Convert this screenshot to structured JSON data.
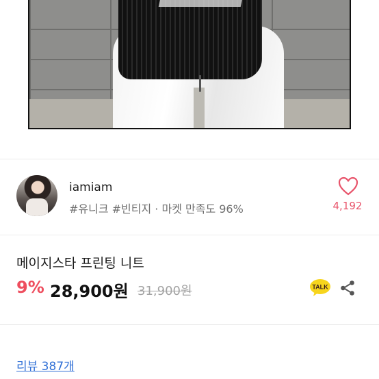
{
  "product_image": {
    "alt": ""
  },
  "seller": {
    "name": "iamiam",
    "tags": "#유니크 #빈티지 · 마켓 만족도 96%",
    "likes": "4,192"
  },
  "product": {
    "title": "메이지스타 프린팅 니트",
    "discount": "9%",
    "price": "28,900원",
    "original_price": "31,900원"
  },
  "actions": {
    "chat_badge": "TALK"
  },
  "reviews": {
    "label": "리뷰 387개"
  },
  "colors": {
    "accent": "#ee4e5e",
    "like": "#e8546b",
    "link": "#2f6fd6",
    "kakao_yellow": "#f7d51d"
  },
  "icons": [
    "heart-icon",
    "kakao-talk-icon",
    "share-icon"
  ]
}
